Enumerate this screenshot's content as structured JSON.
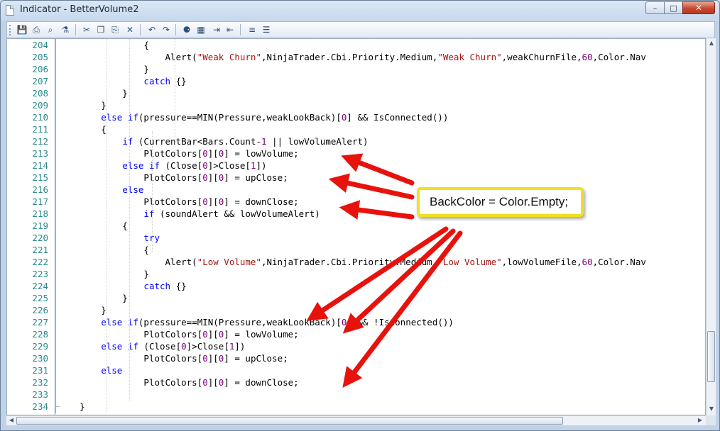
{
  "window": {
    "title": "Indicator - BetterVolume2",
    "minimize_glyph": "–",
    "maximize_glyph": "□",
    "close_glyph": "✕"
  },
  "toolbar": {
    "buttons": [
      {
        "name": "save-icon",
        "glyph": "💾"
      },
      {
        "name": "print-icon",
        "glyph": "⎙"
      },
      {
        "name": "print-preview-icon",
        "glyph": "⌕"
      },
      {
        "name": "page-setup-icon",
        "glyph": "⚗"
      },
      {
        "name": "cut-icon",
        "glyph": "✂"
      },
      {
        "name": "copy-icon",
        "glyph": "❐"
      },
      {
        "name": "paste-icon",
        "glyph": "⎘"
      },
      {
        "name": "delete-icon",
        "glyph": "✕"
      },
      {
        "name": "undo-icon",
        "glyph": "↶"
      },
      {
        "name": "redo-icon",
        "glyph": "↷"
      },
      {
        "name": "find-icon",
        "glyph": "⚈"
      },
      {
        "name": "find-replace-icon",
        "glyph": "▦"
      },
      {
        "name": "indent-icon",
        "glyph": "⇥"
      },
      {
        "name": "outdent-icon",
        "glyph": "⇤"
      },
      {
        "name": "comment-icon",
        "glyph": "≡"
      },
      {
        "name": "uncomment-icon",
        "glyph": "☰"
      }
    ]
  },
  "code_lines": [
    {
      "num": "204",
      "segments": [
        {
          "t": "                {",
          "c": "plain"
        }
      ]
    },
    {
      "num": "205",
      "segments": [
        {
          "t": "                    Alert(",
          "c": "plain"
        },
        {
          "t": "\"Weak Churn\"",
          "c": "string"
        },
        {
          "t": ",NinjaTrader.Cbi.Priority.Medium,",
          "c": "plain"
        },
        {
          "t": "\"Weak Churn\"",
          "c": "string"
        },
        {
          "t": ",weakChurnFile,",
          "c": "plain"
        },
        {
          "t": "60",
          "c": "number"
        },
        {
          "t": ",Color.Nav",
          "c": "plain"
        }
      ]
    },
    {
      "num": "206",
      "segments": [
        {
          "t": "                }",
          "c": "plain"
        }
      ]
    },
    {
      "num": "207",
      "segments": [
        {
          "t": "                ",
          "c": "plain"
        },
        {
          "t": "catch",
          "c": "keyword"
        },
        {
          "t": " {}",
          "c": "plain"
        }
      ]
    },
    {
      "num": "208",
      "segments": [
        {
          "t": "            }",
          "c": "plain"
        }
      ]
    },
    {
      "num": "209",
      "segments": [
        {
          "t": "        }",
          "c": "plain"
        }
      ]
    },
    {
      "num": "210",
      "segments": [
        {
          "t": "        ",
          "c": "plain"
        },
        {
          "t": "else if",
          "c": "keyword"
        },
        {
          "t": "(pressure==MIN(Pressure,weakLookBack)[",
          "c": "plain"
        },
        {
          "t": "0",
          "c": "number"
        },
        {
          "t": "] && IsConnected())",
          "c": "plain"
        }
      ]
    },
    {
      "num": "211",
      "segments": [
        {
          "t": "        {",
          "c": "plain"
        }
      ]
    },
    {
      "num": "212",
      "segments": [
        {
          "t": "            ",
          "c": "plain"
        },
        {
          "t": "if",
          "c": "keyword"
        },
        {
          "t": " (CurrentBar<Bars.Count-",
          "c": "plain"
        },
        {
          "t": "1",
          "c": "number"
        },
        {
          "t": " || lowVolumeAlert)",
          "c": "plain"
        }
      ]
    },
    {
      "num": "213",
      "segments": [
        {
          "t": "                PlotColors[",
          "c": "plain"
        },
        {
          "t": "0",
          "c": "number"
        },
        {
          "t": "][",
          "c": "plain"
        },
        {
          "t": "0",
          "c": "number"
        },
        {
          "t": "] = lowVolume;",
          "c": "plain"
        }
      ]
    },
    {
      "num": "214",
      "segments": [
        {
          "t": "            ",
          "c": "plain"
        },
        {
          "t": "else if",
          "c": "keyword"
        },
        {
          "t": " (Close[",
          "c": "plain"
        },
        {
          "t": "0",
          "c": "number"
        },
        {
          "t": "]>Close[",
          "c": "plain"
        },
        {
          "t": "1",
          "c": "number"
        },
        {
          "t": "])",
          "c": "plain"
        }
      ]
    },
    {
      "num": "215",
      "segments": [
        {
          "t": "                PlotColors[",
          "c": "plain"
        },
        {
          "t": "0",
          "c": "number"
        },
        {
          "t": "][",
          "c": "plain"
        },
        {
          "t": "0",
          "c": "number"
        },
        {
          "t": "] = upClose;",
          "c": "plain"
        }
      ]
    },
    {
      "num": "216",
      "segments": [
        {
          "t": "            ",
          "c": "plain"
        },
        {
          "t": "else",
          "c": "keyword"
        }
      ]
    },
    {
      "num": "217",
      "segments": [
        {
          "t": "                PlotColors[",
          "c": "plain"
        },
        {
          "t": "0",
          "c": "number"
        },
        {
          "t": "][",
          "c": "plain"
        },
        {
          "t": "0",
          "c": "number"
        },
        {
          "t": "] = downClose;",
          "c": "plain"
        }
      ]
    },
    {
      "num": "218",
      "segments": [
        {
          "t": "                ",
          "c": "plain"
        },
        {
          "t": "if",
          "c": "keyword"
        },
        {
          "t": " (soundAlert && lowVolumeAlert)",
          "c": "plain"
        }
      ]
    },
    {
      "num": "219",
      "segments": [
        {
          "t": "            {",
          "c": "plain"
        }
      ]
    },
    {
      "num": "220",
      "segments": [
        {
          "t": "                ",
          "c": "plain"
        },
        {
          "t": "try",
          "c": "keyword"
        }
      ]
    },
    {
      "num": "221",
      "segments": [
        {
          "t": "                {",
          "c": "plain"
        }
      ]
    },
    {
      "num": "222",
      "segments": [
        {
          "t": "                    Alert(",
          "c": "plain"
        },
        {
          "t": "\"Low Volume\"",
          "c": "string"
        },
        {
          "t": ",NinjaTrader.Cbi.Priority.Medium,",
          "c": "plain"
        },
        {
          "t": "\"Low Volume\"",
          "c": "string"
        },
        {
          "t": ",lowVolumeFile,",
          "c": "plain"
        },
        {
          "t": "60",
          "c": "number"
        },
        {
          "t": ",Color.Nav",
          "c": "plain"
        }
      ]
    },
    {
      "num": "223",
      "segments": [
        {
          "t": "                }",
          "c": "plain"
        }
      ]
    },
    {
      "num": "224",
      "segments": [
        {
          "t": "                ",
          "c": "plain"
        },
        {
          "t": "catch",
          "c": "keyword"
        },
        {
          "t": " {}",
          "c": "plain"
        }
      ]
    },
    {
      "num": "225",
      "segments": [
        {
          "t": "            }",
          "c": "plain"
        }
      ]
    },
    {
      "num": "226",
      "segments": [
        {
          "t": "        }",
          "c": "plain"
        }
      ]
    },
    {
      "num": "227",
      "segments": [
        {
          "t": "        ",
          "c": "plain"
        },
        {
          "t": "else if",
          "c": "keyword"
        },
        {
          "t": "(pressure==MIN(Pressure,weakLookBack)[",
          "c": "plain"
        },
        {
          "t": "0",
          "c": "number"
        },
        {
          "t": "] && !IsConnected())",
          "c": "plain"
        }
      ]
    },
    {
      "num": "228",
      "segments": [
        {
          "t": "                PlotColors[",
          "c": "plain"
        },
        {
          "t": "0",
          "c": "number"
        },
        {
          "t": "][",
          "c": "plain"
        },
        {
          "t": "0",
          "c": "number"
        },
        {
          "t": "] = lowVolume;",
          "c": "plain"
        }
      ]
    },
    {
      "num": "229",
      "segments": [
        {
          "t": "        ",
          "c": "plain"
        },
        {
          "t": "else if",
          "c": "keyword"
        },
        {
          "t": " (Close[",
          "c": "plain"
        },
        {
          "t": "0",
          "c": "number"
        },
        {
          "t": "]>Close[",
          "c": "plain"
        },
        {
          "t": "1",
          "c": "number"
        },
        {
          "t": "])",
          "c": "plain"
        }
      ]
    },
    {
      "num": "230",
      "segments": [
        {
          "t": "                PlotColors[",
          "c": "plain"
        },
        {
          "t": "0",
          "c": "number"
        },
        {
          "t": "][",
          "c": "plain"
        },
        {
          "t": "0",
          "c": "number"
        },
        {
          "t": "] = upClose;",
          "c": "plain"
        }
      ]
    },
    {
      "num": "231",
      "segments": [
        {
          "t": "        ",
          "c": "plain"
        },
        {
          "t": "else",
          "c": "keyword"
        }
      ]
    },
    {
      "num": "232",
      "segments": [
        {
          "t": "                PlotColors[",
          "c": "plain"
        },
        {
          "t": "0",
          "c": "number"
        },
        {
          "t": "][",
          "c": "plain"
        },
        {
          "t": "0",
          "c": "number"
        },
        {
          "t": "] = downClose;",
          "c": "plain"
        }
      ]
    },
    {
      "num": "233",
      "segments": [
        {
          "t": "",
          "c": "plain"
        }
      ]
    },
    {
      "num": "234",
      "segments": [
        {
          "t": "    }",
          "c": "plain"
        }
      ]
    }
  ],
  "syntax_colors": {
    "plain": "#000000",
    "keyword": "#0000ff",
    "string": "#a31515",
    "number": "#800080"
  },
  "callout": {
    "text": "BackColor = Color.Empty;",
    "border_color": "#f0e020",
    "arrow_color": "#e8120c"
  }
}
